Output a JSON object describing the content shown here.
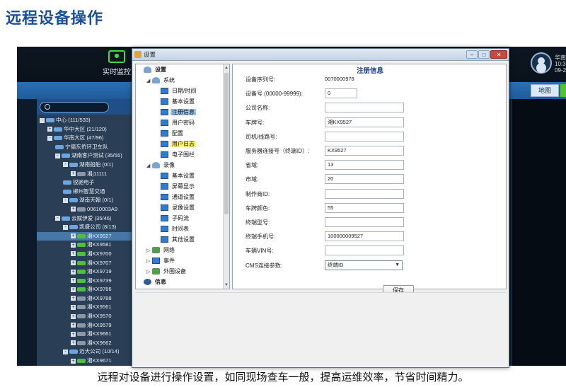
{
  "page": {
    "title": "远程设备操作",
    "caption": "远程对设备进行操作设置，如同现场查车一般，提高运维效率，节省时间精力。"
  },
  "app": {
    "monitor_label": "实时监控",
    "user_lines": [
      "华南",
      "10:3",
      "09-2"
    ],
    "map_button": "地图"
  },
  "device_tree": [
    {
      "indent": 0,
      "toggle": "-",
      "icon": "org",
      "label": "中心 (111/533)"
    },
    {
      "indent": 1,
      "toggle": "+",
      "icon": "org",
      "label": "华中大区 (21/120)"
    },
    {
      "indent": 1,
      "toggle": "-",
      "icon": "org",
      "label": "华南大区 (47/96)"
    },
    {
      "indent": 2,
      "toggle": "",
      "icon": "org",
      "label": "宁德东侨环卫车队"
    },
    {
      "indent": 2,
      "toggle": "-",
      "icon": "org",
      "label": "湖南客户测试 (35/55)"
    },
    {
      "indent": 3,
      "toggle": "-",
      "icon": "org",
      "label": "湖南船舶 (0/1)"
    },
    {
      "indent": 4,
      "toggle": "+",
      "icon": "car-gray",
      "label": "湘j11111"
    },
    {
      "indent": 3,
      "toggle": "",
      "icon": "org",
      "label": "锐驰电子"
    },
    {
      "indent": 3,
      "toggle": "",
      "icon": "org",
      "label": "郴州智慧交通"
    },
    {
      "indent": 3,
      "toggle": "-",
      "icon": "org",
      "label": "湖南天翰 (0/1)"
    },
    {
      "indent": 4,
      "toggle": "+",
      "icon": "car-gray",
      "label": "00610003A9"
    },
    {
      "indent": 2,
      "toggle": "-",
      "icon": "org",
      "label": "云赋伊爱 (35/46)"
    },
    {
      "indent": 3,
      "toggle": "-",
      "icon": "org",
      "label": "凯盛公司 (8/13)"
    },
    {
      "indent": 4,
      "toggle": "+",
      "icon": "car",
      "label": "湘KX9527",
      "selected": true
    },
    {
      "indent": 4,
      "toggle": "+",
      "icon": "car",
      "label": "湘KX9581"
    },
    {
      "indent": 4,
      "toggle": "+",
      "icon": "car",
      "label": "湘KX9700"
    },
    {
      "indent": 4,
      "toggle": "+",
      "icon": "car",
      "label": "湘KX9707"
    },
    {
      "indent": 4,
      "toggle": "+",
      "icon": "car",
      "label": "湘KX9719"
    },
    {
      "indent": 4,
      "toggle": "+",
      "icon": "car",
      "label": "湘KX9739"
    },
    {
      "indent": 4,
      "toggle": "+",
      "icon": "car",
      "label": "湘KX9786"
    },
    {
      "indent": 4,
      "toggle": "+",
      "icon": "car-gray",
      "label": "湘KX9788"
    },
    {
      "indent": 4,
      "toggle": "+",
      "icon": "car-gray",
      "label": "湘KX9561"
    },
    {
      "indent": 4,
      "toggle": "+",
      "icon": "car-gray",
      "label": "湘KX9570"
    },
    {
      "indent": 4,
      "toggle": "+",
      "icon": "car-gray",
      "label": "湘KX9579"
    },
    {
      "indent": 4,
      "toggle": "+",
      "icon": "car-gray",
      "label": "湘KX9661"
    },
    {
      "indent": 4,
      "toggle": "+",
      "icon": "car-gray",
      "label": "湘KX9662"
    },
    {
      "indent": 3,
      "toggle": "-",
      "icon": "org",
      "label": "迈大公司 (10/14)"
    },
    {
      "indent": 4,
      "toggle": "+",
      "icon": "car",
      "label": "湘KX9671"
    }
  ],
  "dialog": {
    "title": "设置",
    "close_label": "✕",
    "settings_tree": [
      {
        "indent": 0,
        "exp": "",
        "icon": "group",
        "label": "设置",
        "bold": true
      },
      {
        "indent": 1,
        "exp": "◢",
        "icon": "group",
        "label": "系统"
      },
      {
        "indent": 2,
        "exp": "",
        "icon": "page",
        "label": "日期/时间"
      },
      {
        "indent": 2,
        "exp": "",
        "icon": "page",
        "label": "基本设置"
      },
      {
        "indent": 2,
        "exp": "",
        "icon": "page",
        "label": "注册信息",
        "highlight": "blue"
      },
      {
        "indent": 2,
        "exp": "",
        "icon": "page",
        "label": "用户密码"
      },
      {
        "indent": 2,
        "exp": "",
        "icon": "page",
        "label": "配置"
      },
      {
        "indent": 2,
        "exp": "",
        "icon": "page",
        "label": "用户日志",
        "highlight": "yellow"
      },
      {
        "indent": 2,
        "exp": "",
        "icon": "page",
        "label": "电子围栏"
      },
      {
        "indent": 1,
        "exp": "◢",
        "icon": "group",
        "label": "录像"
      },
      {
        "indent": 2,
        "exp": "",
        "icon": "page",
        "label": "基本设置"
      },
      {
        "indent": 2,
        "exp": "",
        "icon": "page",
        "label": "屏幕显示"
      },
      {
        "indent": 2,
        "exp": "",
        "icon": "page",
        "label": "通道设置"
      },
      {
        "indent": 2,
        "exp": "",
        "icon": "page",
        "label": "录像设置"
      },
      {
        "indent": 2,
        "exp": "",
        "icon": "page",
        "label": "子码流"
      },
      {
        "indent": 2,
        "exp": "",
        "icon": "page",
        "label": "时间表"
      },
      {
        "indent": 2,
        "exp": "",
        "icon": "page",
        "label": "其他设置"
      },
      {
        "indent": 1,
        "exp": "▷",
        "icon": "net",
        "label": "网络"
      },
      {
        "indent": 1,
        "exp": "▷",
        "icon": "page",
        "label": "事件"
      },
      {
        "indent": 1,
        "exp": "▷",
        "icon": "net",
        "label": "外围设备"
      },
      {
        "indent": 0,
        "exp": "",
        "icon": "info",
        "label": "信息",
        "bold": true
      }
    ],
    "form": {
      "title": "注册信息",
      "rows": [
        {
          "label": "设备序列号:",
          "type": "text",
          "value": "0070000978"
        },
        {
          "label": "设备号 (00000-99999):",
          "type": "input-short",
          "value": "0"
        },
        {
          "label": "公司名称:",
          "type": "input",
          "value": ""
        },
        {
          "label": "车牌号:",
          "type": "input",
          "value": "湘KX9527"
        },
        {
          "label": "司机/线路号:",
          "type": "input",
          "value": ""
        },
        {
          "label": "服务器连接号（终端ID）:",
          "type": "input",
          "value": "KX9527"
        },
        {
          "label": "省域:",
          "type": "input",
          "value": "13"
        },
        {
          "label": "市域:",
          "type": "input",
          "value": "20"
        },
        {
          "label": "制作商ID:",
          "type": "input",
          "value": ""
        },
        {
          "label": "车牌颜色:",
          "type": "input",
          "value": "55"
        },
        {
          "label": "终端型号:",
          "type": "input",
          "value": ""
        },
        {
          "label": "终端手机号:",
          "type": "input",
          "value": "100000009527"
        },
        {
          "label": "车辆VIN号:",
          "type": "input",
          "value": ""
        },
        {
          "label": "CMS连接参数:",
          "type": "select",
          "value": "终端ID"
        }
      ],
      "save_label": "保存"
    }
  }
}
